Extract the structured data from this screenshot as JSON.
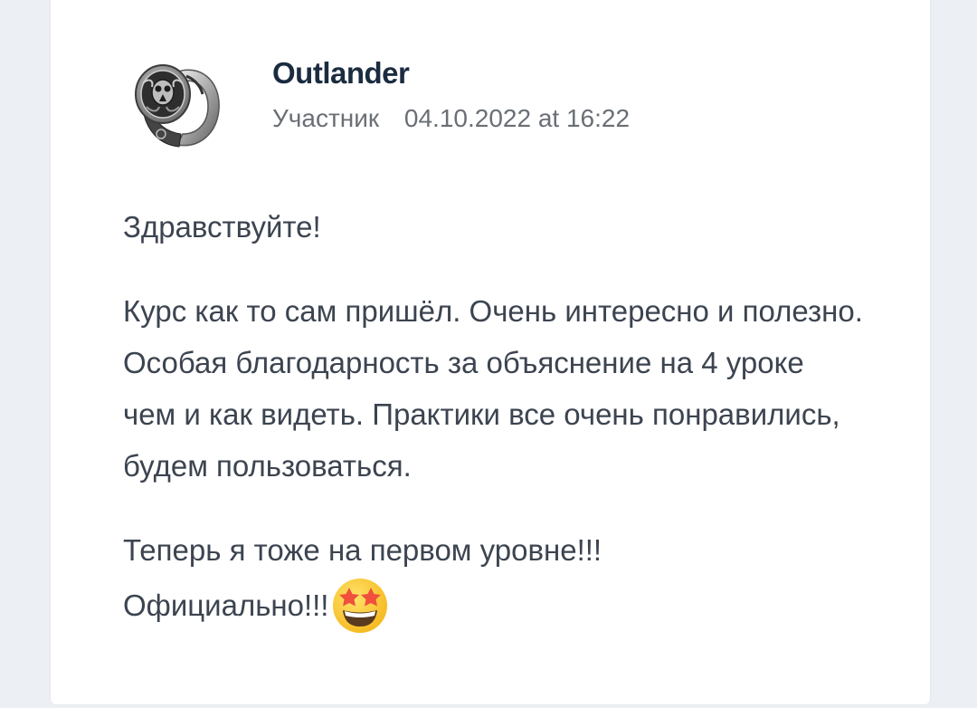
{
  "post": {
    "author": {
      "name": "Outlander",
      "role": "Участник",
      "avatar_icon": "silver-ring-avatar-icon"
    },
    "datetime": "04.10.2022 at 16:22",
    "paragraphs": [
      "Здравствуйте!",
      "Курс как то сам пришёл. Очень интересно и полезно. Особая благодарность за объяснение на 4 уроке чем и как видеть. Практики все очень понравились, будем пользоваться.",
      "Теперь я тоже на первом уровне!!!",
      "Официально!!!"
    ],
    "emoji_icon": "star-struck-emoji-icon"
  },
  "colors": {
    "background": "#eceff3",
    "card": "#ffffff",
    "author_name": "#1b2b40",
    "meta_text": "#6a6f76",
    "body_text": "#3c4450"
  }
}
